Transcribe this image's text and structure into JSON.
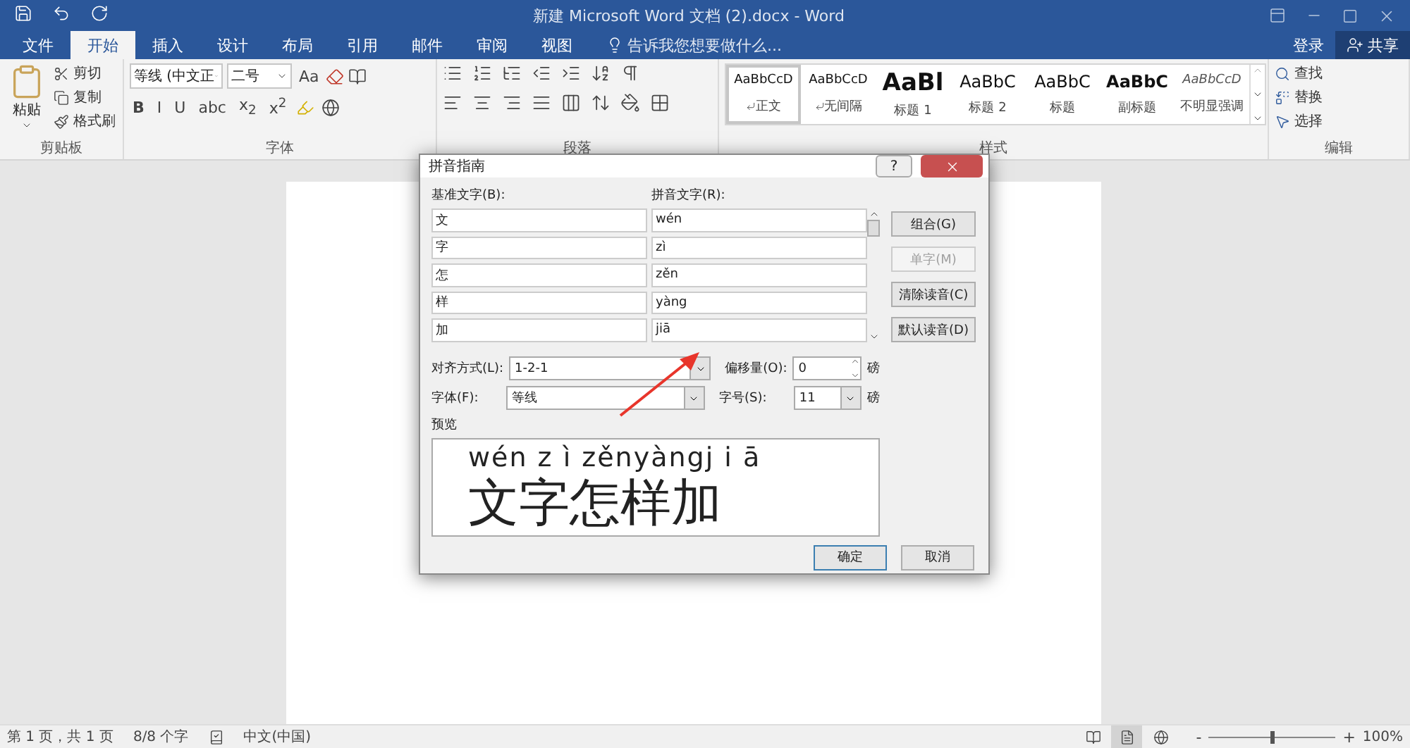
{
  "window": {
    "title": "新建 Microsoft Word 文档 (2).docx - Word"
  },
  "account": {
    "sign_in": "登录",
    "share": "共享"
  },
  "tabs": [
    {
      "label": "文件",
      "selected": false
    },
    {
      "label": "开始",
      "selected": true
    },
    {
      "label": "插入",
      "selected": false
    },
    {
      "label": "设计",
      "selected": false
    },
    {
      "label": "布局",
      "selected": false
    },
    {
      "label": "引用",
      "selected": false
    },
    {
      "label": "邮件",
      "selected": false
    },
    {
      "label": "审阅",
      "selected": false
    },
    {
      "label": "视图",
      "selected": false
    }
  ],
  "tell_me": {
    "placeholder": "告诉我您想要做什么..."
  },
  "ribbon": {
    "clipboard": {
      "label": "剪贴板",
      "paste": "粘贴",
      "actions": [
        "剪切",
        "复制",
        "格式刷"
      ]
    },
    "font": {
      "label": "字体",
      "font_name": "等线 (中文正",
      "font_size": "二号",
      "case": "Aa",
      "format_buttons": [
        "B",
        "I",
        "U",
        "abc",
        "x$_{2}$",
        "x$^{2}$"
      ]
    },
    "paragraph": {
      "label": "段落"
    },
    "styles": {
      "label": "样式",
      "items": [
        {
          "preview": "AaBbCcD",
          "name": "正文",
          "kind": "normal",
          "selected": true
        },
        {
          "preview": "AaBbCcD",
          "name": "无间隔",
          "kind": "normal",
          "selected": false
        },
        {
          "preview": "AaBl",
          "name": "标题 1",
          "kind": "heading",
          "selected": false
        },
        {
          "preview": "AaBbC",
          "name": "标题 2",
          "kind": "subheading",
          "selected": false
        },
        {
          "preview": "AaBbC",
          "name": "标题",
          "kind": "subheading",
          "selected": false
        },
        {
          "preview": "AaBbC",
          "name": "副标题",
          "kind": "strong",
          "selected": false
        },
        {
          "preview": "AaBbCcD",
          "name": "不明显强调",
          "kind": "emphasis",
          "selected": false
        }
      ]
    },
    "editing": {
      "label": "编辑",
      "actions": [
        "查找",
        "替换",
        "选择"
      ]
    }
  },
  "dialog": {
    "title": "拼音指南",
    "help": "?",
    "base_label": "基准文字(B):",
    "ruby_label": "拼音文字(R):",
    "rows": [
      {
        "base": "文",
        "ruby": "wén"
      },
      {
        "base": "字",
        "ruby": "zì"
      },
      {
        "base": "怎",
        "ruby": "zěn"
      },
      {
        "base": "样",
        "ruby": "yàng"
      },
      {
        "base": "加",
        "ruby": "jiā"
      }
    ],
    "buttons": [
      {
        "label": "组合(G)",
        "disabled": false
      },
      {
        "label": "单字(M)",
        "disabled": true
      },
      {
        "label": "清除读音(C)",
        "disabled": false
      },
      {
        "label": "默认读音(D)",
        "disabled": false
      }
    ],
    "alignment": {
      "label": "对齐方式(L):",
      "value": "1-2-1"
    },
    "offset": {
      "label": "偏移量(O):",
      "value": "0",
      "unit": "磅"
    },
    "font": {
      "label": "字体(F):",
      "value": "等线"
    },
    "size": {
      "label": "字号(S):",
      "value": "11",
      "unit": "磅"
    },
    "preview": {
      "label": "预览",
      "pinyin": "wén z ì zěnyàngj i ā",
      "text": "文字怎样加"
    },
    "ok": "确定",
    "cancel": "取消"
  },
  "status_bar": {
    "page": "第 1 页，共 1 页",
    "words": "8/8 个字",
    "language": "中文(中国)",
    "views": [
      {
        "selected": false
      },
      {
        "selected": true
      },
      {
        "selected": false
      }
    ],
    "zoom_out": "-",
    "zoom_in": "+",
    "zoom_slider": {
      "level": 0.5
    },
    "zoom": "100%"
  }
}
